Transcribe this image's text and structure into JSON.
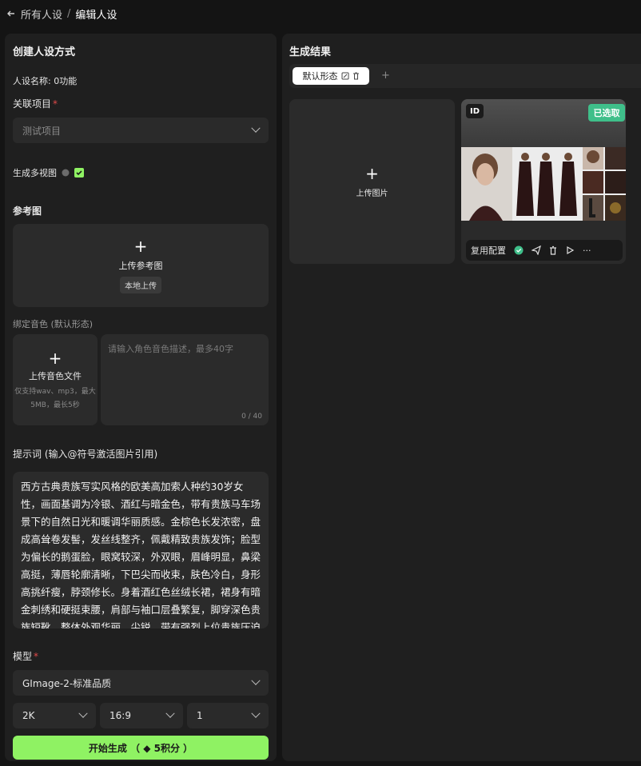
{
  "breadcrumb": {
    "back": "所有人设",
    "separator": "/",
    "current": "编辑人设"
  },
  "left": {
    "title": "创建人设方式",
    "name_label": "人设名称: ",
    "name_value": "0功能",
    "project_label": "关联项目",
    "project_placeholder": "测试项目",
    "multi_view_label": "生成多视图",
    "ref_label": "参考图",
    "ref_upload_label": "上传参考图",
    "ref_local_upload": "本地上传",
    "voice_label": "绑定音色 (默认形态)",
    "voice_upload_label": "上传音色文件",
    "voice_hint_line1": "仅支持wav、mp3，最大",
    "voice_hint_line2": "5MB，最长5秒",
    "voice_desc_placeholder": "请输入角色音色描述，最多40字",
    "voice_counter": "0 / 40",
    "prompt_label": "提示词 (输入@符号激活图片引用)",
    "prompt_text": "西方古典贵族写实风格的欧美高加索人种约30岁女性，画面基调为冷银、酒红与暗金色，带有贵族马车场景下的自然日光和暖调华丽质感。金棕色长发浓密，盘成高耸卷发髻，发丝线整齐，佩戴精致贵族发饰；脸型为偏长的鹅蛋脸，眼窝较深，外双眼，眉峰明显，鼻梁高挺，薄唇轮廓清晰，下巴尖而收束，肤色冷白，身形高挑纤瘦，脖颈修长。身着酒红色丝绒长裙，裙身有暗金刺绣和硬挺束腰，肩部与袖口层叠繁复，脚穿深色贵族短靴。整体外观华丽、尖锐，带有强烈上位贵族压迫感。",
    "model_label": "模型",
    "model_value": "GImage-2-标准品质",
    "resolution": "2K",
    "ratio": "16:9",
    "count": "1",
    "generate_button": "开始生成 （ ◆ 5积分 ）"
  },
  "right": {
    "title": "生成结果",
    "tab_label": "默认形态",
    "add_tab": "+",
    "upload_label": "上传图片",
    "id_badge": "ID",
    "selected_badge": "已选取",
    "reuse_label": "复用配置",
    "more": "···"
  },
  "colors": {
    "accent": "#8ff263",
    "selected": "#3fbf8a",
    "panel": "#1f1f1f",
    "background": "#141414"
  }
}
